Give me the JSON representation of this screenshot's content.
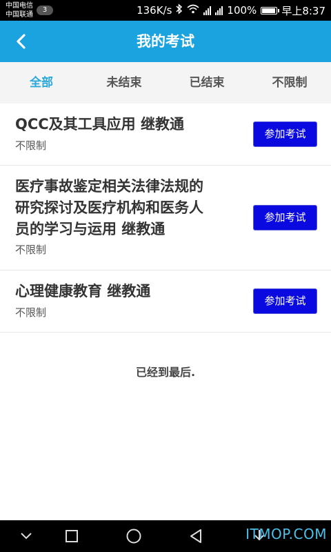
{
  "status_bar": {
    "carrier1": "中国电信",
    "carrier2": "中国联通",
    "badge": "3",
    "speed": "136K/s",
    "battery": "100%",
    "battery_level": 1.0,
    "time": "早上8:37"
  },
  "header": {
    "title": "我的考试",
    "back_icon": "chevron-left-icon"
  },
  "tabs": [
    {
      "label": "全部",
      "active": true
    },
    {
      "label": "未结束",
      "active": false
    },
    {
      "label": "已结束",
      "active": false
    },
    {
      "label": "不限制",
      "active": false
    }
  ],
  "exams": [
    {
      "title_lines": [
        "QCC及其工具应用 继教通"
      ],
      "status": "不限制",
      "button": "参加考试"
    },
    {
      "title_lines": [
        "医疗事故鉴定相关法律法规的",
        "研究探讨及医疗机构和医务人",
        "员的学习与运用 继教通"
      ],
      "status": "不限制",
      "button": "参加考试"
    },
    {
      "title_lines": [
        "心理健康教育 继教通"
      ],
      "status": "不限制",
      "button": "参加考试"
    }
  ],
  "list_end_text": "已经到最后.",
  "watermark": "ITMOP.COM",
  "colors": {
    "header": "#1aa3df",
    "active_tab": "#2aa8d8",
    "button": "#0a0ae0"
  }
}
